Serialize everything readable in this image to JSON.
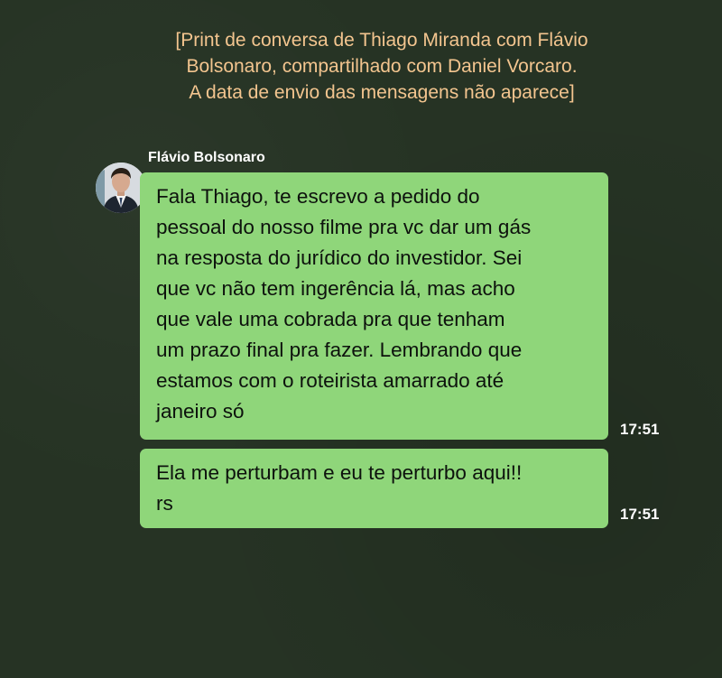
{
  "caption": {
    "lines": [
      "[Print de conversa de Thiago Miranda com Flávio",
      "Bolsonaro, compartilhado com Daniel Vorcaro.",
      "A data de envio das mensagens não aparece]"
    ]
  },
  "conversation": {
    "sender_name": "Flávio Bolsonaro",
    "avatar_icon": "person-avatar",
    "colors": {
      "background": "#263324",
      "caption_text": "#f3c58f",
      "bubble": "#8fd67a",
      "bubble_text": "#0d120d",
      "meta_text": "#ffffff"
    },
    "messages": [
      {
        "lines": [
          "Fala Thiago, te escrevo a pedido do",
          "pessoal do nosso filme pra vc dar um gás",
          "na resposta do jurídico do investidor. Sei",
          "que vc não tem ingerência lá, mas acho",
          "que vale uma cobrada pra que tenham",
          "um prazo final pra fazer. Lembrando que",
          "estamos com o roteirista amarrado até",
          "janeiro só"
        ],
        "time": "17:51"
      },
      {
        "lines": [
          "Ela me perturbam e eu te perturbo aqui!!",
          "rs"
        ],
        "time": "17:51"
      }
    ]
  }
}
